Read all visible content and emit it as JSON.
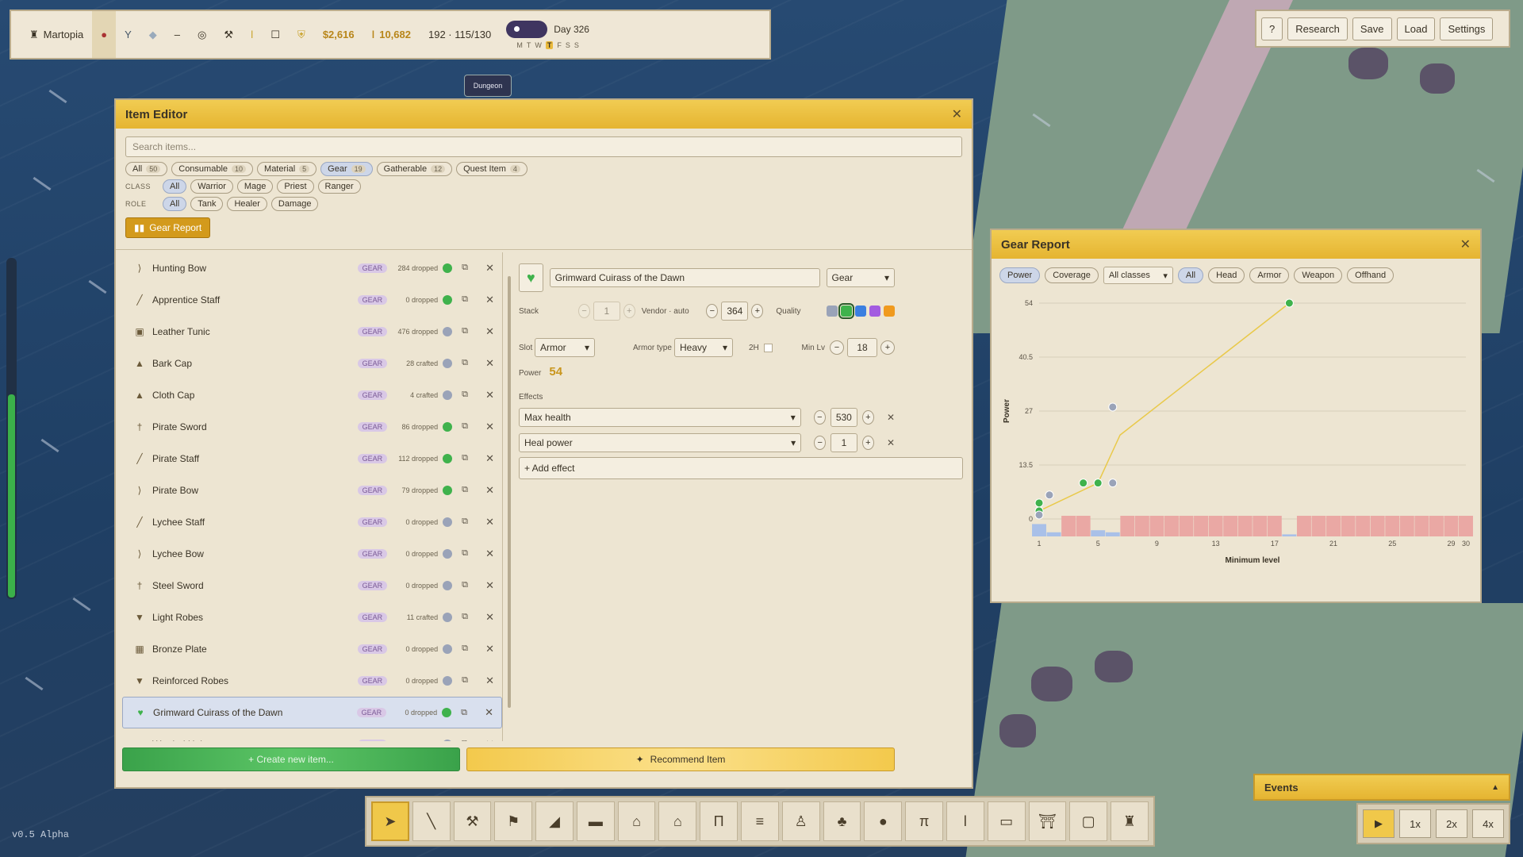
{
  "topbar": {
    "town": "Martopia",
    "gold": "$2,616",
    "mana": "10,682",
    "pop": "192 · 115/130",
    "day": "Day 326",
    "weekdays": [
      "M",
      "T",
      "W",
      "T",
      "F",
      "S",
      "S"
    ]
  },
  "topright": {
    "help": "?",
    "research": "Research",
    "save": "Save",
    "load": "Load",
    "settings": "Settings"
  },
  "item_editor": {
    "title": "Item Editor",
    "search_placeholder": "Search items...",
    "type_filters": [
      {
        "label": "All",
        "count": "50"
      },
      {
        "label": "Consumable",
        "count": "10"
      },
      {
        "label": "Material",
        "count": "5"
      },
      {
        "label": "Gear",
        "count": "19"
      },
      {
        "label": "Gatherable",
        "count": "12"
      },
      {
        "label": "Quest Item",
        "count": "4"
      }
    ],
    "class_label": "CLASS",
    "class_filters": [
      "All",
      "Warrior",
      "Mage",
      "Priest",
      "Ranger"
    ],
    "role_label": "ROLE",
    "role_filters": [
      "All",
      "Tank",
      "Healer",
      "Damage"
    ],
    "gear_report_button": "Gear Report",
    "items": [
      {
        "name": "Hunting Bow",
        "tag": "GEAR",
        "status": "284 dropped",
        "dot": "#3fb24c",
        "icon": "bow-icon"
      },
      {
        "name": "Apprentice Staff",
        "tag": "GEAR",
        "status": "0 dropped",
        "dot": "#3fb24c",
        "icon": "staff-icon"
      },
      {
        "name": "Leather Tunic",
        "tag": "GEAR",
        "status": "476 dropped",
        "dot": "#9aa3b8",
        "icon": "tunic-icon"
      },
      {
        "name": "Bark Cap",
        "tag": "GEAR",
        "status": "28 crafted",
        "dot": "#9aa3b8",
        "icon": "cap-icon"
      },
      {
        "name": "Cloth Cap",
        "tag": "GEAR",
        "status": "4 crafted",
        "dot": "#9aa3b8",
        "icon": "cap-icon"
      },
      {
        "name": "Pirate Sword",
        "tag": "GEAR",
        "status": "86 dropped",
        "dot": "#3fb24c",
        "icon": "sword-icon"
      },
      {
        "name": "Pirate Staff",
        "tag": "GEAR",
        "status": "112 dropped",
        "dot": "#3fb24c",
        "icon": "staff-icon"
      },
      {
        "name": "Pirate Bow",
        "tag": "GEAR",
        "status": "79 dropped",
        "dot": "#3fb24c",
        "icon": "bow-icon"
      },
      {
        "name": "Lychee Staff",
        "tag": "GEAR",
        "status": "0 dropped",
        "dot": "#9aa3b8",
        "icon": "staff-icon"
      },
      {
        "name": "Lychee Bow",
        "tag": "GEAR",
        "status": "0 dropped",
        "dot": "#9aa3b8",
        "icon": "bow-icon"
      },
      {
        "name": "Steel Sword",
        "tag": "GEAR",
        "status": "0 dropped",
        "dot": "#9aa3b8",
        "icon": "sword-icon"
      },
      {
        "name": "Light Robes",
        "tag": "GEAR",
        "status": "11 crafted",
        "dot": "#9aa3b8",
        "icon": "robe-icon"
      },
      {
        "name": "Bronze Plate",
        "tag": "GEAR",
        "status": "0 dropped",
        "dot": "#9aa3b8",
        "icon": "plate-icon"
      },
      {
        "name": "Reinforced Robes",
        "tag": "GEAR",
        "status": "0 dropped",
        "dot": "#9aa3b8",
        "icon": "robe-icon"
      },
      {
        "name": "Grimward Cuirass of the Dawn",
        "tag": "GEAR",
        "status": "0 dropped",
        "dot": "#3fb24c",
        "icon": "cuirass-icon"
      },
      {
        "name": "Warded Helm",
        "tag": "GEAR",
        "status": "0 dropped",
        "dot": "#9aa3b8",
        "icon": "helm-icon"
      }
    ],
    "selected_index": 14,
    "detail": {
      "name": "Grimward Cuirass of the Dawn",
      "type": "Gear",
      "stack_label": "Stack",
      "stack_value": "1",
      "vendor_label": "Vendor · auto",
      "vendor_value": "364",
      "quality_label": "Quality",
      "quality_colors": [
        "#9aa3b8",
        "#3fb24c",
        "#3b7fe0",
        "#a35ce0",
        "#f09a1e"
      ],
      "slot_label": "Slot",
      "slot_value": "Armor",
      "armor_type_label": "Armor type",
      "armor_type_value": "Heavy",
      "twohand_label": "2H",
      "min_lv_label": "Min Lv",
      "min_lv_value": "18",
      "power_label": "Power",
      "power_value": "54",
      "effects_label": "Effects",
      "effects": [
        {
          "name": "Max health",
          "value": "530"
        },
        {
          "name": "Heal power",
          "value": "1"
        }
      ],
      "add_effect": "+ Add effect"
    },
    "create_button": "+ Create new item...",
    "recommend_button": "Recommend Item"
  },
  "gear_report": {
    "title": "Gear Report",
    "tabs": [
      "Power",
      "Coverage"
    ],
    "class_select": "All classes",
    "slot_filters": [
      "All",
      "Head",
      "Armor",
      "Weapon",
      "Offhand"
    ],
    "accent": "#e9c94a"
  },
  "chart_data": {
    "type": "scatter",
    "title": "",
    "xlabel": "Minimum level",
    "ylabel": "Power",
    "xlim": [
      1,
      30
    ],
    "ylim": [
      0,
      54
    ],
    "yticks": [
      "0",
      "13.5",
      "27",
      "40.5",
      "54"
    ],
    "xticks": [
      "1",
      "5",
      "9",
      "13",
      "17",
      "21",
      "25",
      "29",
      "30"
    ],
    "series": [
      {
        "color": "#3fb24c",
        "points": [
          [
            1,
            2
          ],
          [
            1,
            4
          ],
          [
            4,
            9
          ],
          [
            5,
            9
          ],
          [
            5,
            9
          ],
          [
            18,
            54
          ]
        ]
      },
      {
        "color": "#9aa3b8",
        "points": [
          [
            1,
            1
          ],
          [
            1.7,
            6
          ],
          [
            6,
            9
          ],
          [
            6,
            28
          ]
        ]
      }
    ],
    "trend": [
      [
        1,
        2
      ],
      [
        5,
        9
      ],
      [
        6.5,
        21
      ],
      [
        18,
        54
      ]
    ],
    "coverage_bars": [
      {
        "x": 1,
        "color": "#a9c0e8",
        "value": 0.6
      },
      {
        "x": 2,
        "color": "#a9c0e8",
        "value": 0.2
      },
      {
        "x": 3,
        "color": "#eaa8a4",
        "value": 1
      },
      {
        "x": 4,
        "color": "#eaa8a4",
        "value": 1
      },
      {
        "x": 5,
        "color": "#a9c0e8",
        "value": 0.3
      },
      {
        "x": 6,
        "color": "#a9c0e8",
        "value": 0.2
      },
      {
        "x": 7,
        "color": "#eaa8a4",
        "value": 1
      },
      {
        "x": 8,
        "color": "#eaa8a4",
        "value": 1
      },
      {
        "x": 9,
        "color": "#eaa8a4",
        "value": 1
      },
      {
        "x": 10,
        "color": "#eaa8a4",
        "value": 1
      },
      {
        "x": 11,
        "color": "#eaa8a4",
        "value": 1
      },
      {
        "x": 12,
        "color": "#eaa8a4",
        "value": 1
      },
      {
        "x": 13,
        "color": "#eaa8a4",
        "value": 1
      },
      {
        "x": 14,
        "color": "#eaa8a4",
        "value": 1
      },
      {
        "x": 15,
        "color": "#eaa8a4",
        "value": 1
      },
      {
        "x": 16,
        "color": "#eaa8a4",
        "value": 1
      },
      {
        "x": 17,
        "color": "#eaa8a4",
        "value": 1
      },
      {
        "x": 18,
        "color": "#a9c0e8",
        "value": 0.1
      },
      {
        "x": 19,
        "color": "#eaa8a4",
        "value": 1
      },
      {
        "x": 20,
        "color": "#eaa8a4",
        "value": 1
      },
      {
        "x": 21,
        "color": "#eaa8a4",
        "value": 1
      },
      {
        "x": 22,
        "color": "#eaa8a4",
        "value": 1
      },
      {
        "x": 23,
        "color": "#eaa8a4",
        "value": 1
      },
      {
        "x": 24,
        "color": "#eaa8a4",
        "value": 1
      },
      {
        "x": 25,
        "color": "#eaa8a4",
        "value": 1
      },
      {
        "x": 26,
        "color": "#eaa8a4",
        "value": 1
      },
      {
        "x": 27,
        "color": "#eaa8a4",
        "value": 1
      },
      {
        "x": 28,
        "color": "#eaa8a4",
        "value": 1
      },
      {
        "x": 29,
        "color": "#eaa8a4",
        "value": 1
      },
      {
        "x": 30,
        "color": "#eaa8a4",
        "value": 1
      }
    ]
  },
  "events": {
    "label": "Events",
    "arrow": "▲"
  },
  "speed": {
    "play": "▶",
    "s1": "1x",
    "s2": "2x",
    "s4": "4x"
  },
  "tools": [
    "pointer-icon",
    "stick-icon",
    "hammer-icon",
    "flag-icon",
    "ramp-icon",
    "chest-icon",
    "hut-icon",
    "house-icon",
    "gate-icon",
    "bridge-icon",
    "statue-icon",
    "tree-icon",
    "rock-icon",
    "table-icon",
    "torch-icon",
    "bench-icon",
    "shrine-icon",
    "portal-icon",
    "tower-icon"
  ],
  "map_label": {
    "dungeon": "Dungeon"
  },
  "version": "v0.5 Alpha",
  "energy_level": 0.6
}
